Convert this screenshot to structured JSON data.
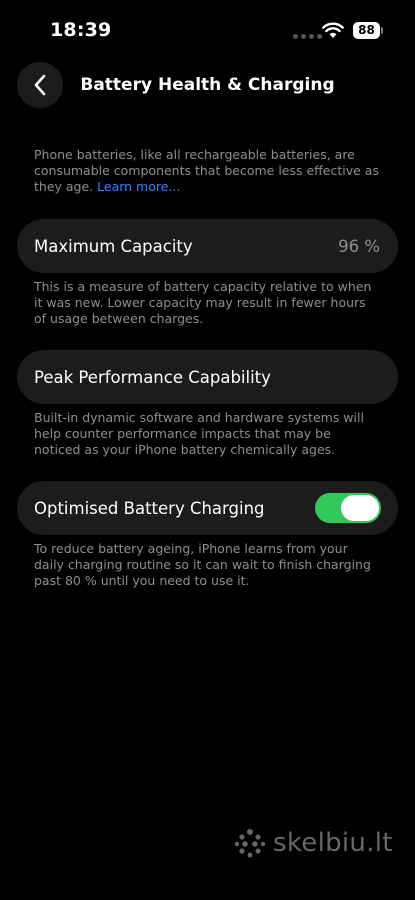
{
  "status_bar": {
    "time": "18:39",
    "battery_level": "88"
  },
  "nav": {
    "title": "Battery Health & Charging"
  },
  "intro": {
    "text": "Phone batteries, like all rechargeable batteries, are consumable components that become less effective as they age.",
    "link": "Learn more..."
  },
  "max_capacity": {
    "label": "Maximum Capacity",
    "value": "96 %",
    "footnote": "This is a measure of battery capacity relative to when it was new. Lower capacity may result in fewer hours of usage between charges."
  },
  "peak_performance": {
    "label": "Peak Performance Capability",
    "footnote": "Built-in dynamic software and hardware systems will help counter performance impacts that may be noticed as your iPhone battery chemically ages."
  },
  "optimised_charging": {
    "label": "Optimised Battery Charging",
    "enabled": true,
    "footnote": "To reduce battery ageing, iPhone learns from your daily charging routine so it can wait to finish charging past 80 % until you need to use it."
  },
  "watermark": {
    "text": "skelbiu.lt"
  },
  "colors": {
    "accent": "#3b82f6",
    "toggle_on": "#34c759",
    "card_bg": "#1c1c1e"
  }
}
